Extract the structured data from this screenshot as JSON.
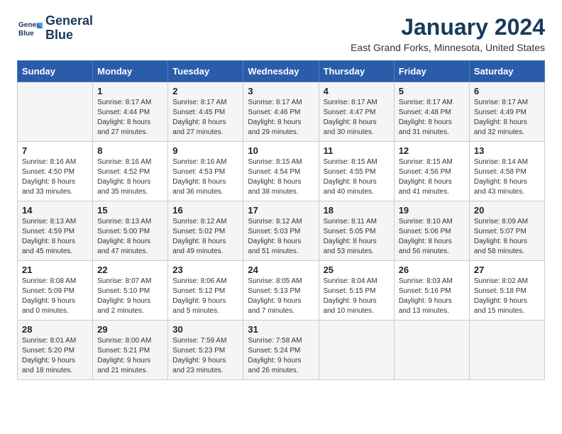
{
  "logo": {
    "line1": "General",
    "line2": "Blue"
  },
  "title": "January 2024",
  "subtitle": "East Grand Forks, Minnesota, United States",
  "days_header": [
    "Sunday",
    "Monday",
    "Tuesday",
    "Wednesday",
    "Thursday",
    "Friday",
    "Saturday"
  ],
  "weeks": [
    [
      {
        "day": "",
        "info": ""
      },
      {
        "day": "1",
        "info": "Sunrise: 8:17 AM\nSunset: 4:44 PM\nDaylight: 8 hours\nand 27 minutes."
      },
      {
        "day": "2",
        "info": "Sunrise: 8:17 AM\nSunset: 4:45 PM\nDaylight: 8 hours\nand 27 minutes."
      },
      {
        "day": "3",
        "info": "Sunrise: 8:17 AM\nSunset: 4:46 PM\nDaylight: 8 hours\nand 29 minutes."
      },
      {
        "day": "4",
        "info": "Sunrise: 8:17 AM\nSunset: 4:47 PM\nDaylight: 8 hours\nand 30 minutes."
      },
      {
        "day": "5",
        "info": "Sunrise: 8:17 AM\nSunset: 4:48 PM\nDaylight: 8 hours\nand 31 minutes."
      },
      {
        "day": "6",
        "info": "Sunrise: 8:17 AM\nSunset: 4:49 PM\nDaylight: 8 hours\nand 32 minutes."
      }
    ],
    [
      {
        "day": "7",
        "info": "Sunrise: 8:16 AM\nSunset: 4:50 PM\nDaylight: 8 hours\nand 33 minutes."
      },
      {
        "day": "8",
        "info": "Sunrise: 8:16 AM\nSunset: 4:52 PM\nDaylight: 8 hours\nand 35 minutes."
      },
      {
        "day": "9",
        "info": "Sunrise: 8:16 AM\nSunset: 4:53 PM\nDaylight: 8 hours\nand 36 minutes."
      },
      {
        "day": "10",
        "info": "Sunrise: 8:15 AM\nSunset: 4:54 PM\nDaylight: 8 hours\nand 38 minutes."
      },
      {
        "day": "11",
        "info": "Sunrise: 8:15 AM\nSunset: 4:55 PM\nDaylight: 8 hours\nand 40 minutes."
      },
      {
        "day": "12",
        "info": "Sunrise: 8:15 AM\nSunset: 4:56 PM\nDaylight: 8 hours\nand 41 minutes."
      },
      {
        "day": "13",
        "info": "Sunrise: 8:14 AM\nSunset: 4:58 PM\nDaylight: 8 hours\nand 43 minutes."
      }
    ],
    [
      {
        "day": "14",
        "info": "Sunrise: 8:13 AM\nSunset: 4:59 PM\nDaylight: 8 hours\nand 45 minutes."
      },
      {
        "day": "15",
        "info": "Sunrise: 8:13 AM\nSunset: 5:00 PM\nDaylight: 8 hours\nand 47 minutes."
      },
      {
        "day": "16",
        "info": "Sunrise: 8:12 AM\nSunset: 5:02 PM\nDaylight: 8 hours\nand 49 minutes."
      },
      {
        "day": "17",
        "info": "Sunrise: 8:12 AM\nSunset: 5:03 PM\nDaylight: 8 hours\nand 51 minutes."
      },
      {
        "day": "18",
        "info": "Sunrise: 8:11 AM\nSunset: 5:05 PM\nDaylight: 8 hours\nand 53 minutes."
      },
      {
        "day": "19",
        "info": "Sunrise: 8:10 AM\nSunset: 5:06 PM\nDaylight: 8 hours\nand 56 minutes."
      },
      {
        "day": "20",
        "info": "Sunrise: 8:09 AM\nSunset: 5:07 PM\nDaylight: 8 hours\nand 58 minutes."
      }
    ],
    [
      {
        "day": "21",
        "info": "Sunrise: 8:08 AM\nSunset: 5:09 PM\nDaylight: 9 hours\nand 0 minutes."
      },
      {
        "day": "22",
        "info": "Sunrise: 8:07 AM\nSunset: 5:10 PM\nDaylight: 9 hours\nand 2 minutes."
      },
      {
        "day": "23",
        "info": "Sunrise: 8:06 AM\nSunset: 5:12 PM\nDaylight: 9 hours\nand 5 minutes."
      },
      {
        "day": "24",
        "info": "Sunrise: 8:05 AM\nSunset: 5:13 PM\nDaylight: 9 hours\nand 7 minutes."
      },
      {
        "day": "25",
        "info": "Sunrise: 8:04 AM\nSunset: 5:15 PM\nDaylight: 9 hours\nand 10 minutes."
      },
      {
        "day": "26",
        "info": "Sunrise: 8:03 AM\nSunset: 5:16 PM\nDaylight: 9 hours\nand 13 minutes."
      },
      {
        "day": "27",
        "info": "Sunrise: 8:02 AM\nSunset: 5:18 PM\nDaylight: 9 hours\nand 15 minutes."
      }
    ],
    [
      {
        "day": "28",
        "info": "Sunrise: 8:01 AM\nSunset: 5:20 PM\nDaylight: 9 hours\nand 18 minutes."
      },
      {
        "day": "29",
        "info": "Sunrise: 8:00 AM\nSunset: 5:21 PM\nDaylight: 9 hours\nand 21 minutes."
      },
      {
        "day": "30",
        "info": "Sunrise: 7:59 AM\nSunset: 5:23 PM\nDaylight: 9 hours\nand 23 minutes."
      },
      {
        "day": "31",
        "info": "Sunrise: 7:58 AM\nSunset: 5:24 PM\nDaylight: 9 hours\nand 26 minutes."
      },
      {
        "day": "",
        "info": ""
      },
      {
        "day": "",
        "info": ""
      },
      {
        "day": "",
        "info": ""
      }
    ]
  ]
}
